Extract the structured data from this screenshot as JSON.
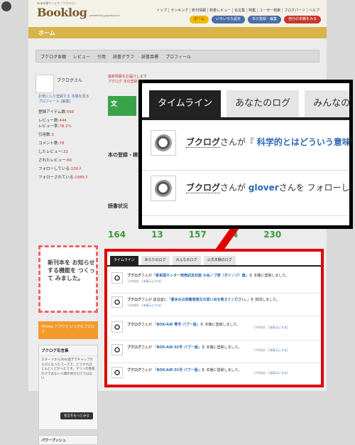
{
  "site": {
    "tagline": "web本棚サービス「ブクログ」",
    "logo": "Booklog",
    "logo_sub": "presented by paperboy&co.",
    "topnav": [
      "トップ",
      "ランキング",
      "新刊情報",
      "新着レビュー",
      "名言集",
      "特集",
      "ユーザー検索",
      "ブログパーツ",
      "ヘルプ"
    ],
    "pills": [
      "ホーム",
      "いろいろな設定",
      "本の登録・編集",
      "自分の本棚をみる"
    ],
    "home_label": "ホーム"
  },
  "subnav": [
    "ブクログ本棚",
    "レビュー",
    "引用",
    "読書グラフ",
    "読書目標",
    "プロフィール"
  ],
  "sidebar": {
    "username": "ブクログさん",
    "profile_links": [
      "お気に入り登録する 本棚を見る",
      "プロフィール [編集]"
    ],
    "stats": [
      {
        "label": "登録アイテム数:",
        "value": "568"
      },
      {
        "label": "レビュー数:",
        "value": "444"
      },
      {
        "label": "レビュー率:",
        "value": "78.2%"
      },
      {
        "label": "引用数:",
        "value": "3"
      },
      {
        "label": "コメント数:",
        "value": "78"
      },
      {
        "label": "したレビュー:",
        "value": "32"
      },
      {
        "label": "されたレビュー:",
        "value": "66"
      },
      {
        "label": "フォローしている:",
        "value": "100人"
      },
      {
        "label": "フォローされている:",
        "value": "1985人"
      }
    ],
    "ad_text": "新刊本を お知らせ する機能を つくって みました。",
    "ad2_text": "iPhone アプリで いつでもブクログ",
    "box_title": "ブクログ名言集",
    "box_text": "スタートから30分過ぎでギャップだらけになったコースで、どうすればとんどくどかったです。マリンの性能だけではない人間の体力だけではない",
    "box_button": "名言をもっとみる",
    "pb_title": "パワープッシュ"
  },
  "middle": {
    "links": [
      "最新情報をお届けします",
      "ブクログ 本の登録"
    ],
    "green": "文",
    "register_title": "本の登録・検索",
    "reading_title": "読書状況",
    "numbers": [
      "164",
      "13",
      "157",
      "4",
      "230"
    ]
  },
  "zoom": {
    "tabs": [
      "タイムライン",
      "あなたのログ",
      "みんなのログ"
    ],
    "rows": [
      {
        "user": "ブクログ",
        "mid": "さんが『",
        "link": "科学的とはどういう意味"
      },
      {
        "user": "ブクログ",
        "mid": "さんが",
        "link": "glover",
        "tail": "さんを フォローし"
      }
    ]
  },
  "feed": {
    "tabs": [
      "タイムライン",
      "あなたのログ",
      "みんなのログ",
      "公式本棚のログ"
    ],
    "items": [
      {
        "user": "ブクログ",
        "pre": "さんが「",
        "link": "家系図カッター発売記念対談 大谷ノブ彦（ダイノジ）篇",
        "post": "」を 本棚に登録しました。",
        "time": "14時間前",
        "hide": "[非表示にする]"
      },
      {
        "user": "ブクログ",
        "pre": "さんが 談話室に「",
        "link": "夏休みの読書感想文の思い出を教えてください。",
        "post": "」を 質問しました。",
        "time": "14時間前",
        "hide": "[非表示にする]"
      },
      {
        "user": "ブクログ",
        "pre": "さんが 「",
        "link": "BOX-AiR 零号 パブー版",
        "post": "」を 本棚に登録しました。",
        "time": "15時間前",
        "hide": "[非表示にする]"
      },
      {
        "user": "ブクログ",
        "pre": "さんが 「",
        "link": "BOX-AiR 02号 パブー版",
        "post": "」を 本棚に登録しました。",
        "time": "15時間前",
        "hide": "[非表示にする]"
      },
      {
        "user": "ブクログ",
        "pre": "さんが 「",
        "link": "BOX-AiR 01号 パブー版",
        "post": "」を 本棚に登録しました。",
        "time": "15時間前",
        "hide": "[非表示にする]"
      }
    ]
  },
  "colors": {
    "highlight_red": "#e00000",
    "tab_active": "#222222",
    "link_blue": "#2a6bb5",
    "header_gold": "#d8b34a"
  }
}
